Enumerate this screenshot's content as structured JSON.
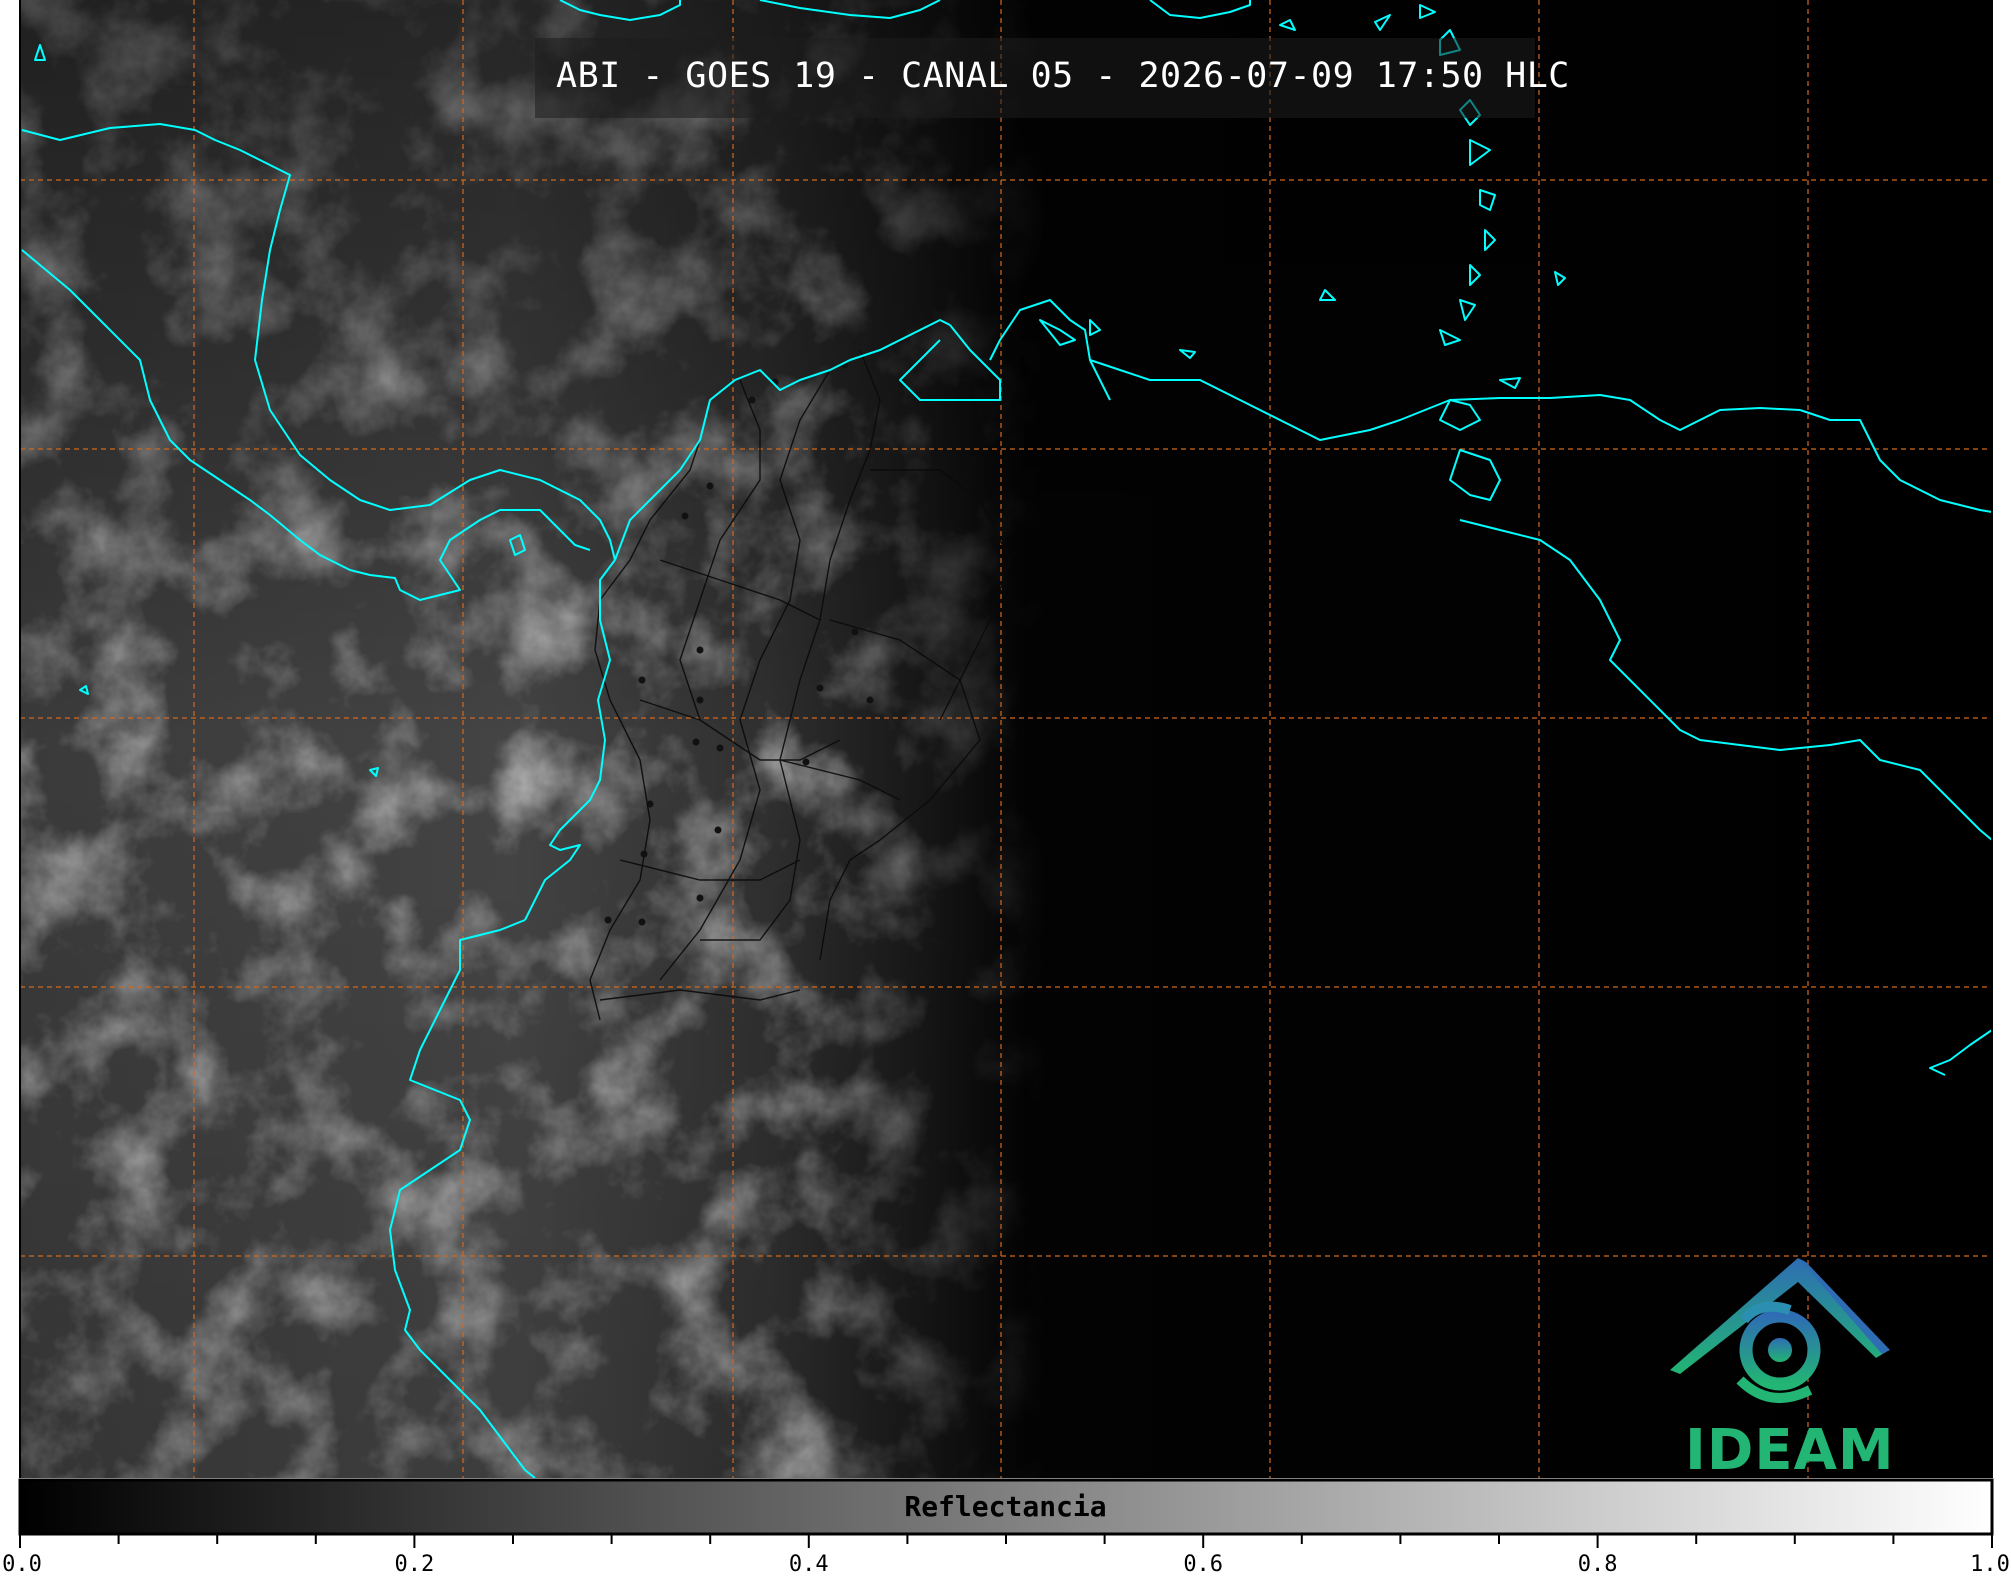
{
  "title": "ABI - GOES 19 - CANAL 05 - 2026-07-09 17:50 HLC",
  "logo": {
    "name": "IDEAM",
    "text_color": "#22b573",
    "arch_color": "#2e6db4"
  },
  "colors": {
    "coastline": "#00ffff",
    "graticule": "#d2691e",
    "background": "#000000",
    "borders": "#000000"
  },
  "colorbar": {
    "label": "Reflectancia",
    "min": 0.0,
    "max": 1.0,
    "colormap": "grayscale",
    "tick_labels": [
      "0.0",
      "0.2",
      "0.4",
      "0.6",
      "0.8",
      "1.0"
    ],
    "tick_values": [
      0.0,
      0.2,
      0.4,
      0.6,
      0.8,
      1.0
    ],
    "minor_tick_step": 0.05
  }
}
